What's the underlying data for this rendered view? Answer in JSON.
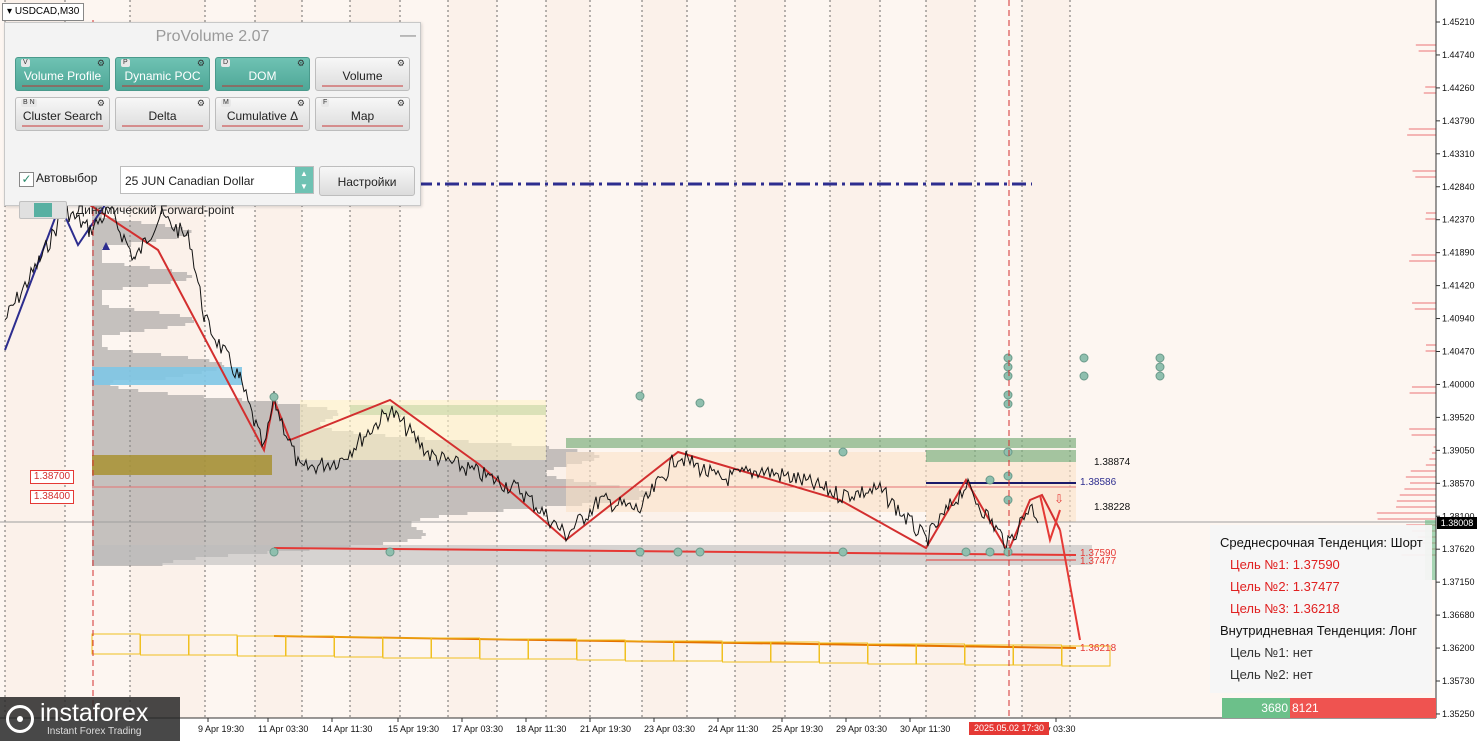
{
  "symbol_tab": "USDCAD,M30",
  "panel": {
    "title": "ProVolume 2.07",
    "minimize": "—",
    "buttons": [
      {
        "key": "V",
        "label": "Volume Profile",
        "on": true
      },
      {
        "key": "P",
        "label": "Dynamic POC",
        "on": true
      },
      {
        "key": "D",
        "label": "DOM",
        "on": true
      },
      {
        "key": "",
        "label": "Volume",
        "on": false
      },
      {
        "key": "B N",
        "label": "Cluster Search",
        "on": false
      },
      {
        "key": "",
        "label": "Delta",
        "on": false
      },
      {
        "key": "M",
        "label": "Cumulative Δ",
        "on": false
      },
      {
        "key": "F",
        "label": "Map",
        "on": false
      }
    ],
    "autoselect_label": "Автовыбор",
    "contract_value": "25 JUN Canadian Dollar",
    "settings_label": "Настройки",
    "forward_point_label": "Динамический Forward-point"
  },
  "price_axis": [
    "1.45210",
    "1.44740",
    "1.44260",
    "1.43790",
    "1.43310",
    "1.42840",
    "1.42370",
    "1.41890",
    "1.41420",
    "1.40940",
    "1.40470",
    "1.40000",
    "1.39520",
    "1.39050",
    "1.38570",
    "1.38100",
    "1.37620",
    "1.37150",
    "1.36680",
    "1.36200",
    "1.35730",
    "1.35250"
  ],
  "current_price": "1.38008",
  "time_axis": [
    "9 Apr 19:30",
    "11 Apr 03:30",
    "14 Apr 11:30",
    "15 Apr 19:30",
    "17 Apr 03:30",
    "18 Apr 11:30",
    "21 Apr 19:30",
    "23 Apr 03:30",
    "24 Apr 11:30",
    "25 Apr 19:30",
    "29 Apr 03:30",
    "30 Apr 11:30",
    "y 03:30"
  ],
  "highlighted_date": "2025.05.02 17:30",
  "levels": {
    "l1": "1.38874",
    "l2": "1.38586",
    "l3": "1.38228",
    "l4": "1.37590",
    "l5": "1.37477",
    "l6": "1.36218"
  },
  "left_boxes": [
    "1.38700",
    "1.38400"
  ],
  "info": {
    "mid_trend": "Среднесрочная Тенденция: Шорт",
    "targets_mid": [
      "Цель №1: 1.37590",
      "Цель №2: 1.37477",
      "Цель №3: 1.36218"
    ],
    "intraday": "Внутридневная Тенденция: Лонг",
    "targets_intra": [
      "Цель №1: нет",
      "Цель №2: нет"
    ]
  },
  "volume": {
    "buy": "3680",
    "sell": "8121"
  },
  "logo": {
    "name": "instaforex",
    "tagline": "Instant Forex Trading"
  },
  "colors": {
    "red": "#e53935",
    "teal": "#58b0a2",
    "navy": "#2d2d8f",
    "green": "#6cc08a"
  }
}
